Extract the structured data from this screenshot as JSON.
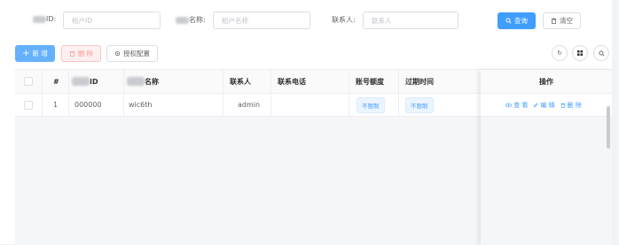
{
  "search": {
    "fields": [
      {
        "label_suffix": "ID:",
        "placeholder": "租户ID"
      },
      {
        "label_suffix": "名称:",
        "placeholder": "租户名称"
      },
      {
        "label": "联系人:",
        "placeholder": "联系人"
      }
    ],
    "query_label": "查询",
    "clear_label": "清空"
  },
  "toolbar": {
    "add_label": "新 增",
    "delete_label": "删 除",
    "auth_label": "授权配置"
  },
  "table": {
    "columns": {
      "index": "#",
      "id_suffix": "ID",
      "name_suffix": "名称",
      "contact": "联系人",
      "phone": "联系电话",
      "quota": "账号额度",
      "expire": "过期时间",
      "actions": "操作"
    },
    "rows": [
      {
        "index": "1",
        "id": "000000",
        "name": "wic6th",
        "contact": "admin",
        "phone": "",
        "quota": "不限制",
        "expire": "不限制",
        "view": "查 看",
        "edit": "编 辑",
        "delete": "删 除"
      }
    ]
  },
  "colors": {
    "primary": "#409eff",
    "danger": "#f56c6c",
    "border": "#dcdfe6"
  },
  "icons": [
    "search-icon",
    "trash-icon",
    "plus-icon",
    "gear-icon",
    "refresh-icon",
    "grid-icon",
    "eye-icon",
    "edit-icon"
  ]
}
